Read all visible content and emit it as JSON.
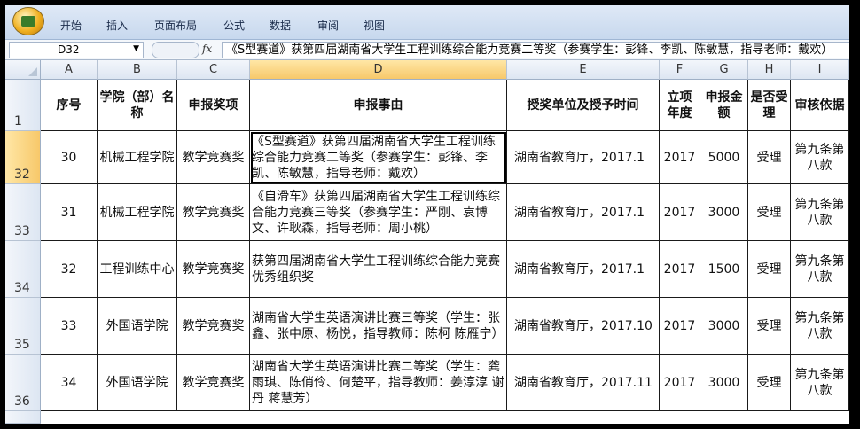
{
  "ribbon": {
    "tabs": [
      "开始",
      "插入",
      "页面布局",
      "公式",
      "数据",
      "审阅",
      "视图"
    ]
  },
  "formula_bar": {
    "name_box": "D32",
    "fx_label": "fx",
    "content": "《S型赛道》获第四届湖南省大学生工程训练综合能力竞赛二等奖（参赛学生：彭锋、李凯、陈敏慧，指导老师：戴欢）"
  },
  "columns": [
    "A",
    "B",
    "C",
    "D",
    "E",
    "F",
    "G",
    "H",
    "I"
  ],
  "header_row": {
    "row_number": "1",
    "cells": [
      "序号",
      "学院（部）名称",
      "申报奖项",
      "申报事由",
      "授奖单位及授予时间",
      "立项年度",
      "申报金额",
      "是否受理",
      "审核依据"
    ]
  },
  "rows": [
    {
      "row_number": "32",
      "cells": [
        "30",
        "机械工程学院",
        "教学竞赛奖",
        "《S型赛道》获第四届湖南省大学生工程训练综合能力竞赛二等奖（参赛学生：彭锋、李凯、陈敏慧，指导老师：戴欢）",
        "湖南省教育厅，2017.1",
        "2017",
        "5000",
        "受理",
        "第九条第八款"
      ]
    },
    {
      "row_number": "33",
      "cells": [
        "31",
        "机械工程学院",
        "教学竞赛奖",
        "《自滑车》获第四届湖南省大学生工程训练综合能力竞赛三等奖（参赛学生：严刚、袁博文、许耿森，指导老师：周小桃）",
        "湖南省教育厅，2017.1",
        "2017",
        "3000",
        "受理",
        "第九条第八款"
      ]
    },
    {
      "row_number": "34",
      "cells": [
        "32",
        "工程训练中心",
        "教学竞赛奖",
        "获第四届湖南省大学生工程训练综合能力竞赛优秀组织奖",
        "湖南省教育厅，2017.1",
        "2017",
        "1500",
        "受理",
        "第九条第八款"
      ]
    },
    {
      "row_number": "35",
      "cells": [
        "33",
        "外国语学院",
        "教学竞赛奖",
        "湖南省大学生英语演讲比赛三等奖（学生：张鑫、张中原、杨悦，指导教师：陈柯 陈雁宁）",
        "湖南省教育厅，2017.10",
        "2017",
        "3000",
        "受理",
        "第九条第八款"
      ]
    },
    {
      "row_number": "36",
      "cells": [
        "34",
        "外国语学院",
        "教学竞赛奖",
        "湖南省大学生英语演讲比赛二等奖（学生：龚雨琪、陈俏伶、何楚平，指导教师：姜淳淳 谢丹 蒋慧芳）",
        "湖南省教育厅，2017.11",
        "2017",
        "3000",
        "受理",
        "第九条第八款"
      ]
    }
  ],
  "selected_cell": {
    "row": "32",
    "column": "D"
  }
}
